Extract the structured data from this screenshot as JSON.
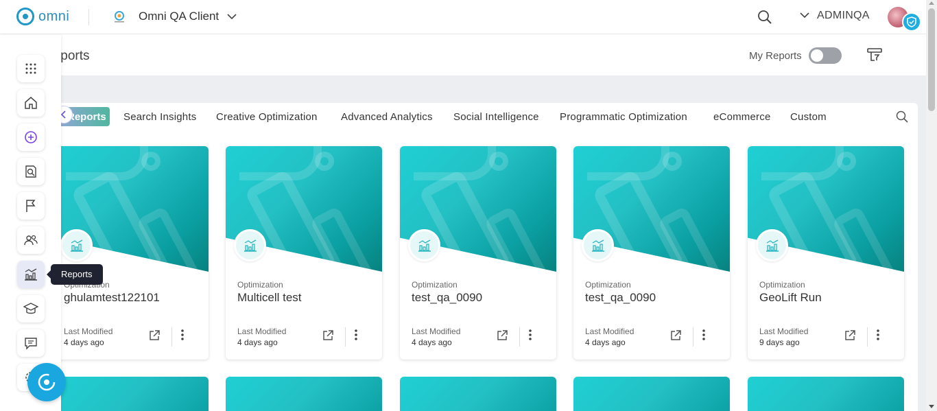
{
  "header": {
    "logo_text": "omni",
    "client_name": "Omni QA Client",
    "user_name": "ADMINQA"
  },
  "page": {
    "title": "Reports",
    "my_reports_label": "My Reports",
    "my_reports_enabled": false
  },
  "tabs": [
    {
      "label": "Reports",
      "active": true
    },
    {
      "label": "Search Insights"
    },
    {
      "label": "Creative Optimization"
    },
    {
      "label": "Advanced Analytics"
    },
    {
      "label": "Social Intelligence"
    },
    {
      "label": "Programmatic Optimization"
    },
    {
      "label": "eCommerce"
    },
    {
      "label": "Custom"
    }
  ],
  "cards": [
    {
      "type": "Optimization",
      "title": "ghulamtest122101",
      "modified_label": "Last Modified",
      "modified": "4 days ago"
    },
    {
      "type": "Optimization",
      "title": "Multicell test",
      "modified_label": "Last Modified",
      "modified": "4 days ago"
    },
    {
      "type": "Optimization",
      "title": "test_qa_0090",
      "modified_label": "Last Modified",
      "modified": "4 days ago"
    },
    {
      "type": "Optimization",
      "title": "test_qa_0090",
      "modified_label": "Last Modified",
      "modified": "4 days ago"
    },
    {
      "type": "Optimization",
      "title": "GeoLift Run",
      "modified_label": "Last Modified",
      "modified": "9 days ago"
    }
  ],
  "sidebar": {
    "items": [
      {
        "name": "apps",
        "icon": "grid-icon"
      },
      {
        "name": "home",
        "icon": "home-icon"
      },
      {
        "name": "create",
        "icon": "plus-circle-icon"
      },
      {
        "name": "audience",
        "icon": "search-doc-icon"
      },
      {
        "name": "flag",
        "icon": "flag-icon"
      },
      {
        "name": "users",
        "icon": "users-icon"
      },
      {
        "name": "reports",
        "icon": "chart-icon",
        "active": true
      },
      {
        "name": "learn",
        "icon": "graduation-cap-icon"
      },
      {
        "name": "messages",
        "icon": "chat-icon"
      },
      {
        "name": "settings",
        "icon": "gear-icon"
      }
    ],
    "tooltip": "Reports"
  },
  "colors": {
    "brand": "#2196c9",
    "card_teal": "#1fd0d4",
    "tooltip_bg": "#1f2230",
    "fab": "#1aa7e0"
  }
}
